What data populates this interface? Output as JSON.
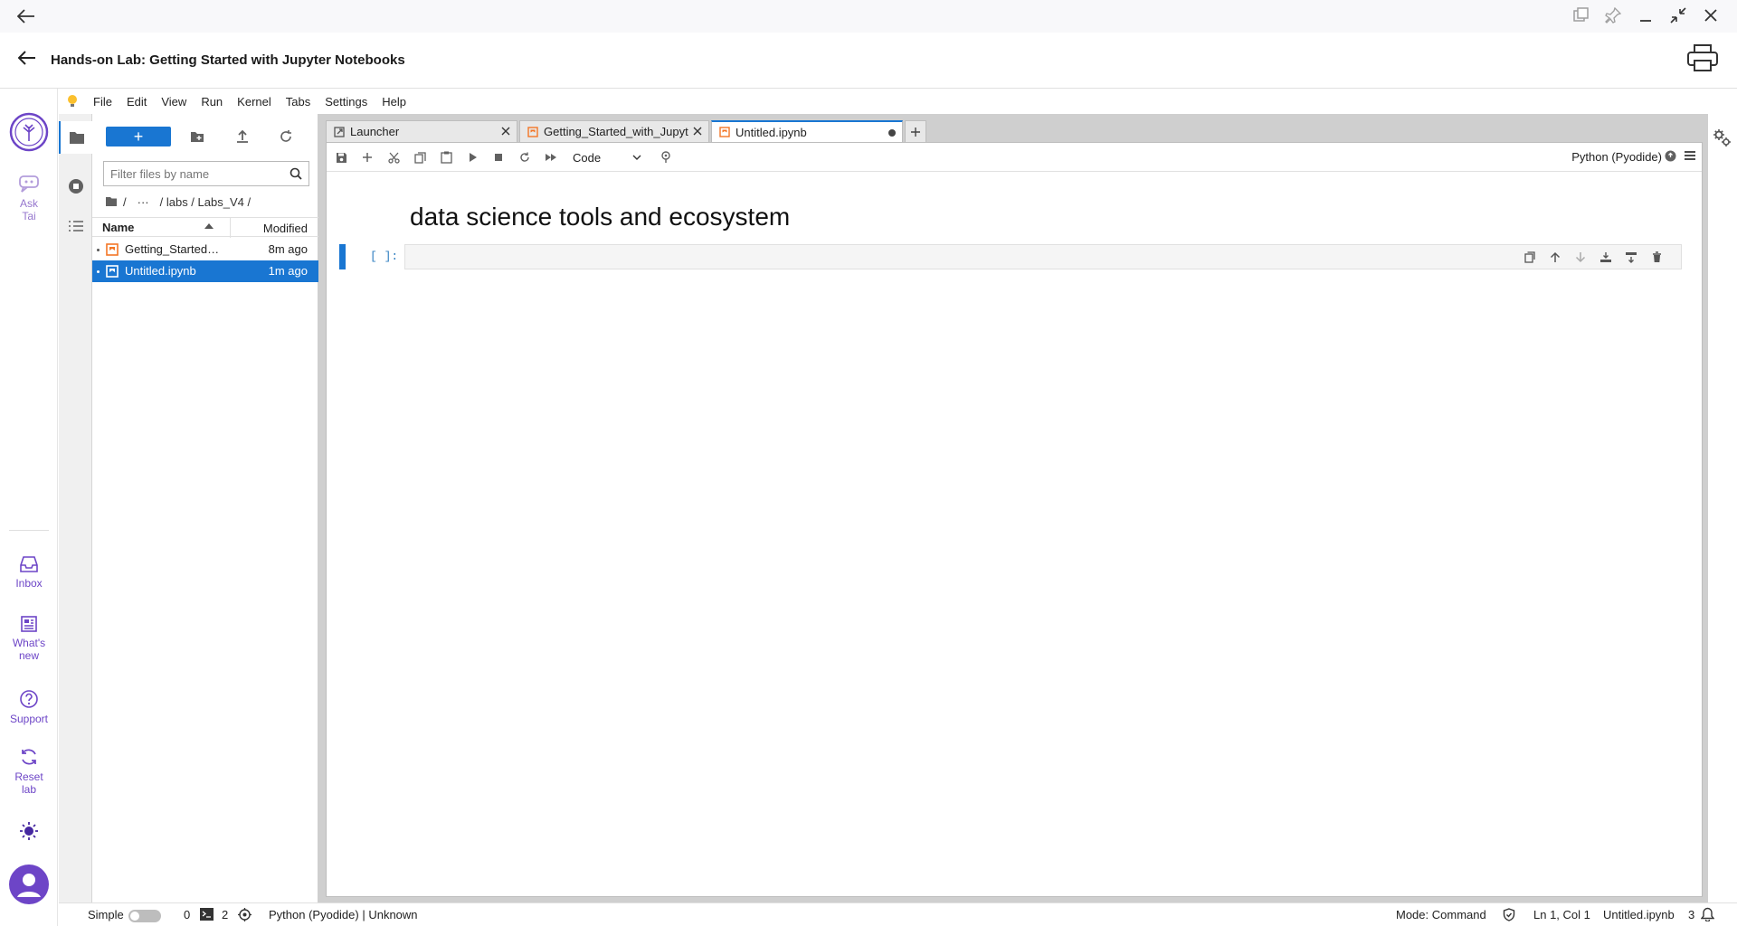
{
  "chrome": {
    "title": "Hands-on Lab: Getting Started with Jupyter Notebooks"
  },
  "rail": {
    "ask_label_1": "Ask",
    "ask_label_2": "Tai",
    "inbox": "Inbox",
    "whats_new_1": "What's",
    "whats_new_2": "new",
    "support": "Support",
    "reset_1": "Reset",
    "reset_2": "lab"
  },
  "menu": [
    "File",
    "Edit",
    "View",
    "Run",
    "Kernel",
    "Tabs",
    "Settings",
    "Help"
  ],
  "filebrowser": {
    "new_label": "+",
    "filter_placeholder": "Filter files by name",
    "crumbs": [
      "/",
      "···",
      "/ labs / Labs_V4 /"
    ],
    "col_name": "Name",
    "col_modified": "Modified",
    "files": [
      {
        "name": "Getting_Started_with_Jupyter_Notebooks.ipynb",
        "modified": "8m ago"
      },
      {
        "name": "Untitled.ipynb",
        "modified": "1m ago"
      }
    ]
  },
  "tabs": [
    {
      "label": "Launcher"
    },
    {
      "label": "Getting_Started_with_Jupyter_Notebooks.ipynb"
    },
    {
      "label": "Untitled.ipynb"
    }
  ],
  "notebook": {
    "cell_type": "Code",
    "kernel": "Python (Pyodide)",
    "heading": "data science tools and ecosystem",
    "prompt": "[ ]:"
  },
  "status": {
    "mode_label": "Simple",
    "terminals": "0",
    "kernels": "2",
    "kernel_state": "Python (Pyodide) | Unknown",
    "mode": "Mode: Command",
    "position": "Ln 1, Col 1",
    "filename": "Untitled.ipynb",
    "notifications": "3"
  },
  "colors": {
    "accent": "#1976d2",
    "brand": "#6d45c7",
    "notebook_icon": "#f37626"
  }
}
